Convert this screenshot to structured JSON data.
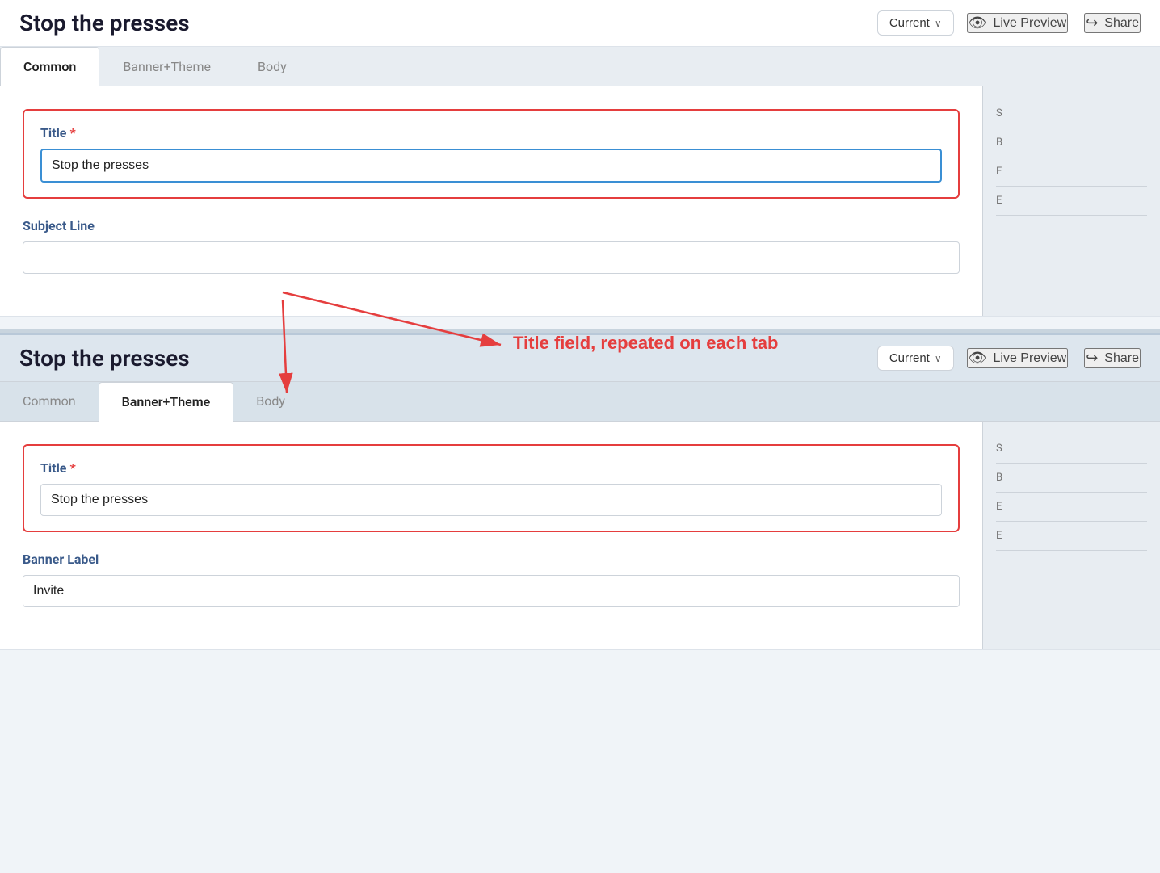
{
  "app": {
    "title": "Stop the presses"
  },
  "panel1": {
    "header": {
      "title": "Stop the presses",
      "version_label": "Current",
      "live_preview_label": "Live Preview",
      "share_label": "Share"
    },
    "tabs": [
      {
        "id": "common",
        "label": "Common",
        "active": true
      },
      {
        "id": "banner-theme",
        "label": "Banner+Theme",
        "active": false
      },
      {
        "id": "body",
        "label": "Body",
        "active": false
      }
    ],
    "title_field": {
      "label": "Title",
      "value": "Stop the presses",
      "required": true
    },
    "subject_line_field": {
      "label": "Subject Line",
      "value": "",
      "placeholder": ""
    }
  },
  "annotation": {
    "text": "Title field, repeated on each tab"
  },
  "panel2": {
    "header": {
      "title": "Stop the presses",
      "version_label": "Current",
      "live_preview_label": "Live Preview",
      "share_label": "Share"
    },
    "tabs": [
      {
        "id": "common",
        "label": "Common",
        "active": false
      },
      {
        "id": "banner-theme",
        "label": "Banner+Theme",
        "active": true
      },
      {
        "id": "body",
        "label": "Body",
        "active": false
      }
    ],
    "title_field": {
      "label": "Title",
      "value": "Stop the presses",
      "required": true
    },
    "banner_label_field": {
      "label": "Banner Label",
      "value": "Invite"
    }
  },
  "icons": {
    "eye": "👁",
    "share": "➦",
    "chevron": "∨"
  }
}
